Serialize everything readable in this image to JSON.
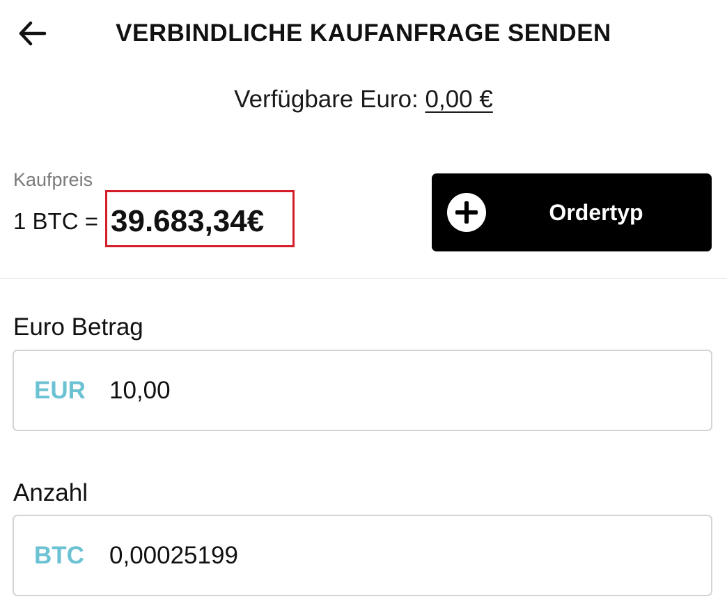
{
  "header": {
    "title": "VERBINDLICHE KAUFANFRAGE SENDEN",
    "back_icon": "arrow-left-icon"
  },
  "balance": {
    "label": "Verfügbare Euro:",
    "value": "0,00 €"
  },
  "price": {
    "caption": "Kaufpreis",
    "prefix": "1 BTC =",
    "value": "39.683,34€",
    "highlight_color": "#d61e2b"
  },
  "order_button": {
    "label": "Ordertyp",
    "icon": "plus-circle-icon",
    "background": "#000000"
  },
  "euro_field": {
    "label": "Euro Betrag",
    "currency": "EUR",
    "value": "10,00"
  },
  "btc_field": {
    "label": "Anzahl",
    "currency": "BTC",
    "value": "0,00025199"
  },
  "colors": {
    "accent": "#6cc2d3",
    "text": "#111111",
    "muted": "#7a7a7a",
    "border": "#d4d4d4"
  }
}
